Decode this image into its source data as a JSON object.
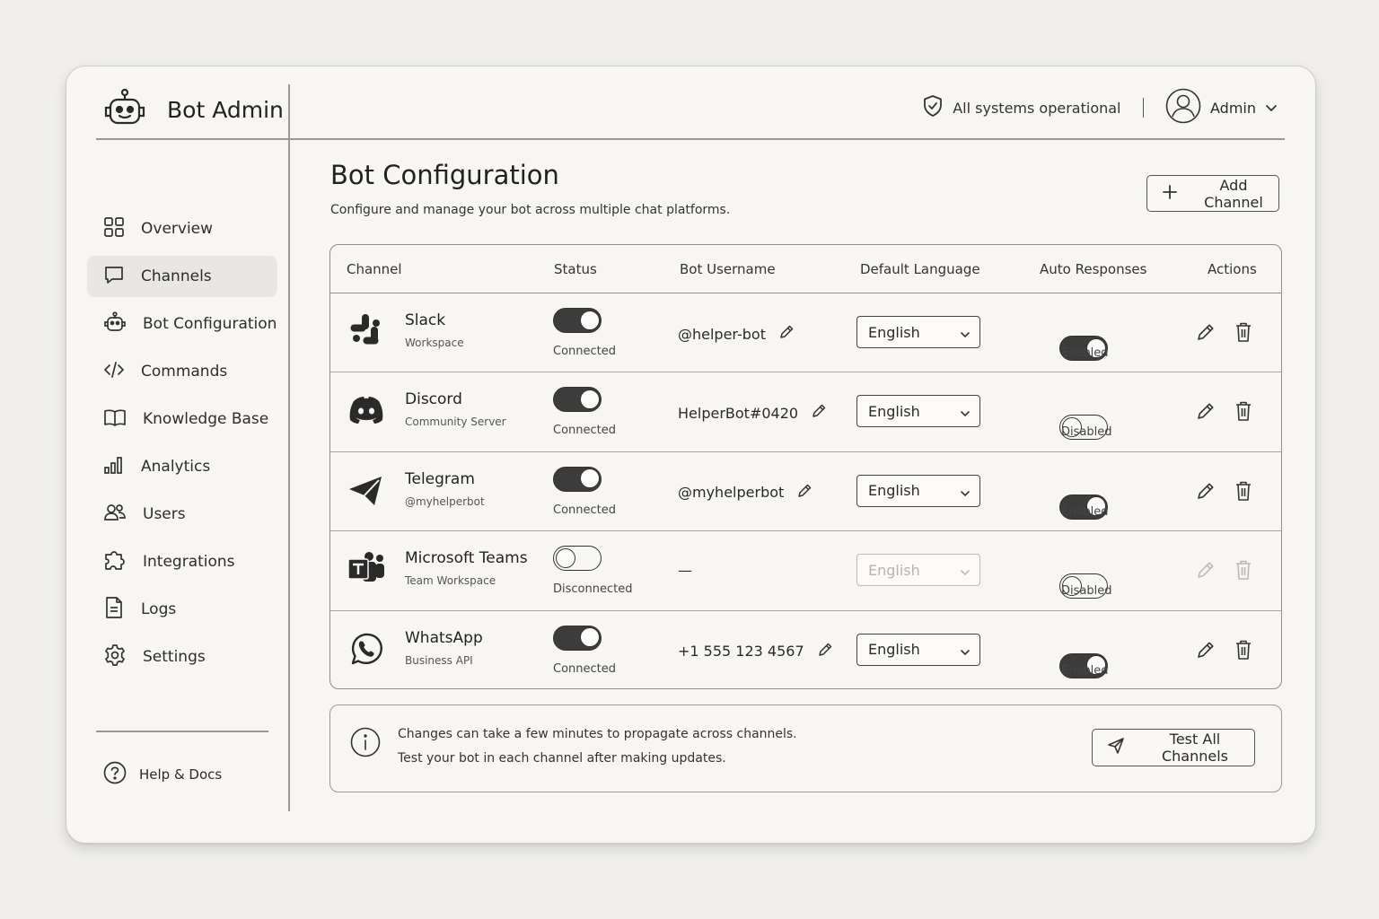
{
  "app": {
    "title": "Bot Admin"
  },
  "topbar": {
    "status_text": "All systems operational",
    "user_name": "Admin"
  },
  "sidebar": {
    "items": [
      {
        "label": "Overview",
        "icon": "grid-icon",
        "active": false
      },
      {
        "label": "Channels",
        "icon": "chat-bubble-icon",
        "active": true
      },
      {
        "label": "Bot Configuration",
        "icon": "robot-icon",
        "active": false
      },
      {
        "label": "Commands",
        "icon": "code-icon",
        "active": false
      },
      {
        "label": "Knowledge Base",
        "icon": "book-icon",
        "active": false
      },
      {
        "label": "Analytics",
        "icon": "bar-chart-icon",
        "active": false
      },
      {
        "label": "Users",
        "icon": "users-icon",
        "active": false
      },
      {
        "label": "Integrations",
        "icon": "puzzle-icon",
        "active": false
      },
      {
        "label": "Logs",
        "icon": "document-icon",
        "active": false
      },
      {
        "label": "Settings",
        "icon": "gear-icon",
        "active": false
      }
    ],
    "help_label": "Help & Docs"
  },
  "main": {
    "title": "Bot Configuration",
    "subtitle": "Configure and manage your bot across multiple chat platforms.",
    "add_button": "Add Channel"
  },
  "table": {
    "headers": [
      "Channel",
      "Status",
      "Bot Username",
      "Default Language",
      "Auto Responses",
      "Actions"
    ],
    "rows": [
      {
        "channel": "Slack",
        "subtitle": "Workspace",
        "icon": "slack-icon",
        "status": "Connected",
        "connected": true,
        "username": "@helper-bot",
        "language": "English",
        "auto": "Enabled",
        "auto_on": true
      },
      {
        "channel": "Discord",
        "subtitle": "Community Server",
        "icon": "discord-icon",
        "status": "Connected",
        "connected": true,
        "username": "HelperBot#0420",
        "language": "English",
        "auto": "Disabled",
        "auto_on": false
      },
      {
        "channel": "Telegram",
        "subtitle": "@myhelperbot",
        "icon": "telegram-icon",
        "status": "Connected",
        "connected": true,
        "username": "@myhelperbot",
        "language": "English",
        "auto": "Enabled",
        "auto_on": true
      },
      {
        "channel": "Microsoft Teams",
        "subtitle": "Team Workspace",
        "icon": "teams-icon",
        "status": "Disconnected",
        "connected": false,
        "username": "—",
        "language": "English",
        "auto": "Disabled",
        "auto_on": false
      },
      {
        "channel": "WhatsApp",
        "subtitle": "Business API",
        "icon": "whatsapp-icon",
        "status": "Connected",
        "connected": true,
        "username": "+1 555 123 4567",
        "language": "English",
        "auto": "Enabled",
        "auto_on": true
      }
    ]
  },
  "info": {
    "line1": "Changes can take a few minutes to propagate across channels.",
    "line2": "Test your bot in each channel after making updates.",
    "button": "Test All Channels"
  }
}
